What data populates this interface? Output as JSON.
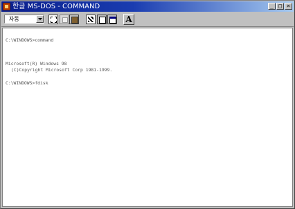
{
  "window": {
    "title": "한글 MS-DOS - COMMAND"
  },
  "title_buttons": {
    "minimize": "_",
    "maximize": "□",
    "close": "×"
  },
  "toolbar": {
    "font_size": "자동",
    "font_button": "A"
  },
  "console": {
    "lines": [
      "C:\\WINDOWS>command",
      "Microsoft(R) Windows 98",
      "(C)Copyright Microsoft Corp 1981-1999.",
      "C:\\WINDOWS>fdisk"
    ]
  }
}
